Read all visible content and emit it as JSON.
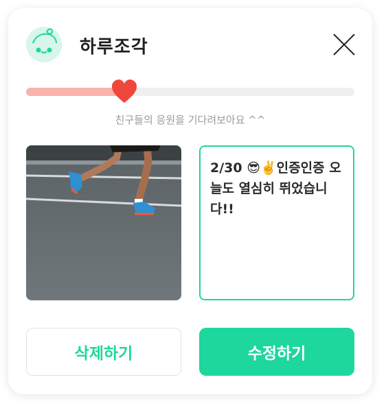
{
  "app": {
    "title": "하루조각"
  },
  "progress": {
    "value": 0.3,
    "helper_text": "친구들의 응원을 기다려보아요 ^^"
  },
  "photo": {
    "subject": "running-shoes-photo"
  },
  "memo": {
    "text": "2/30 😎✌️인증인증 오늘도 열심히 뛰었습니다!!"
  },
  "buttons": {
    "delete_label": "삭제하기",
    "edit_label": "수정하기"
  },
  "colors": {
    "accent": "#1ed79c",
    "progress_fill": "#f8b3ac",
    "heart": "#f0463c"
  }
}
